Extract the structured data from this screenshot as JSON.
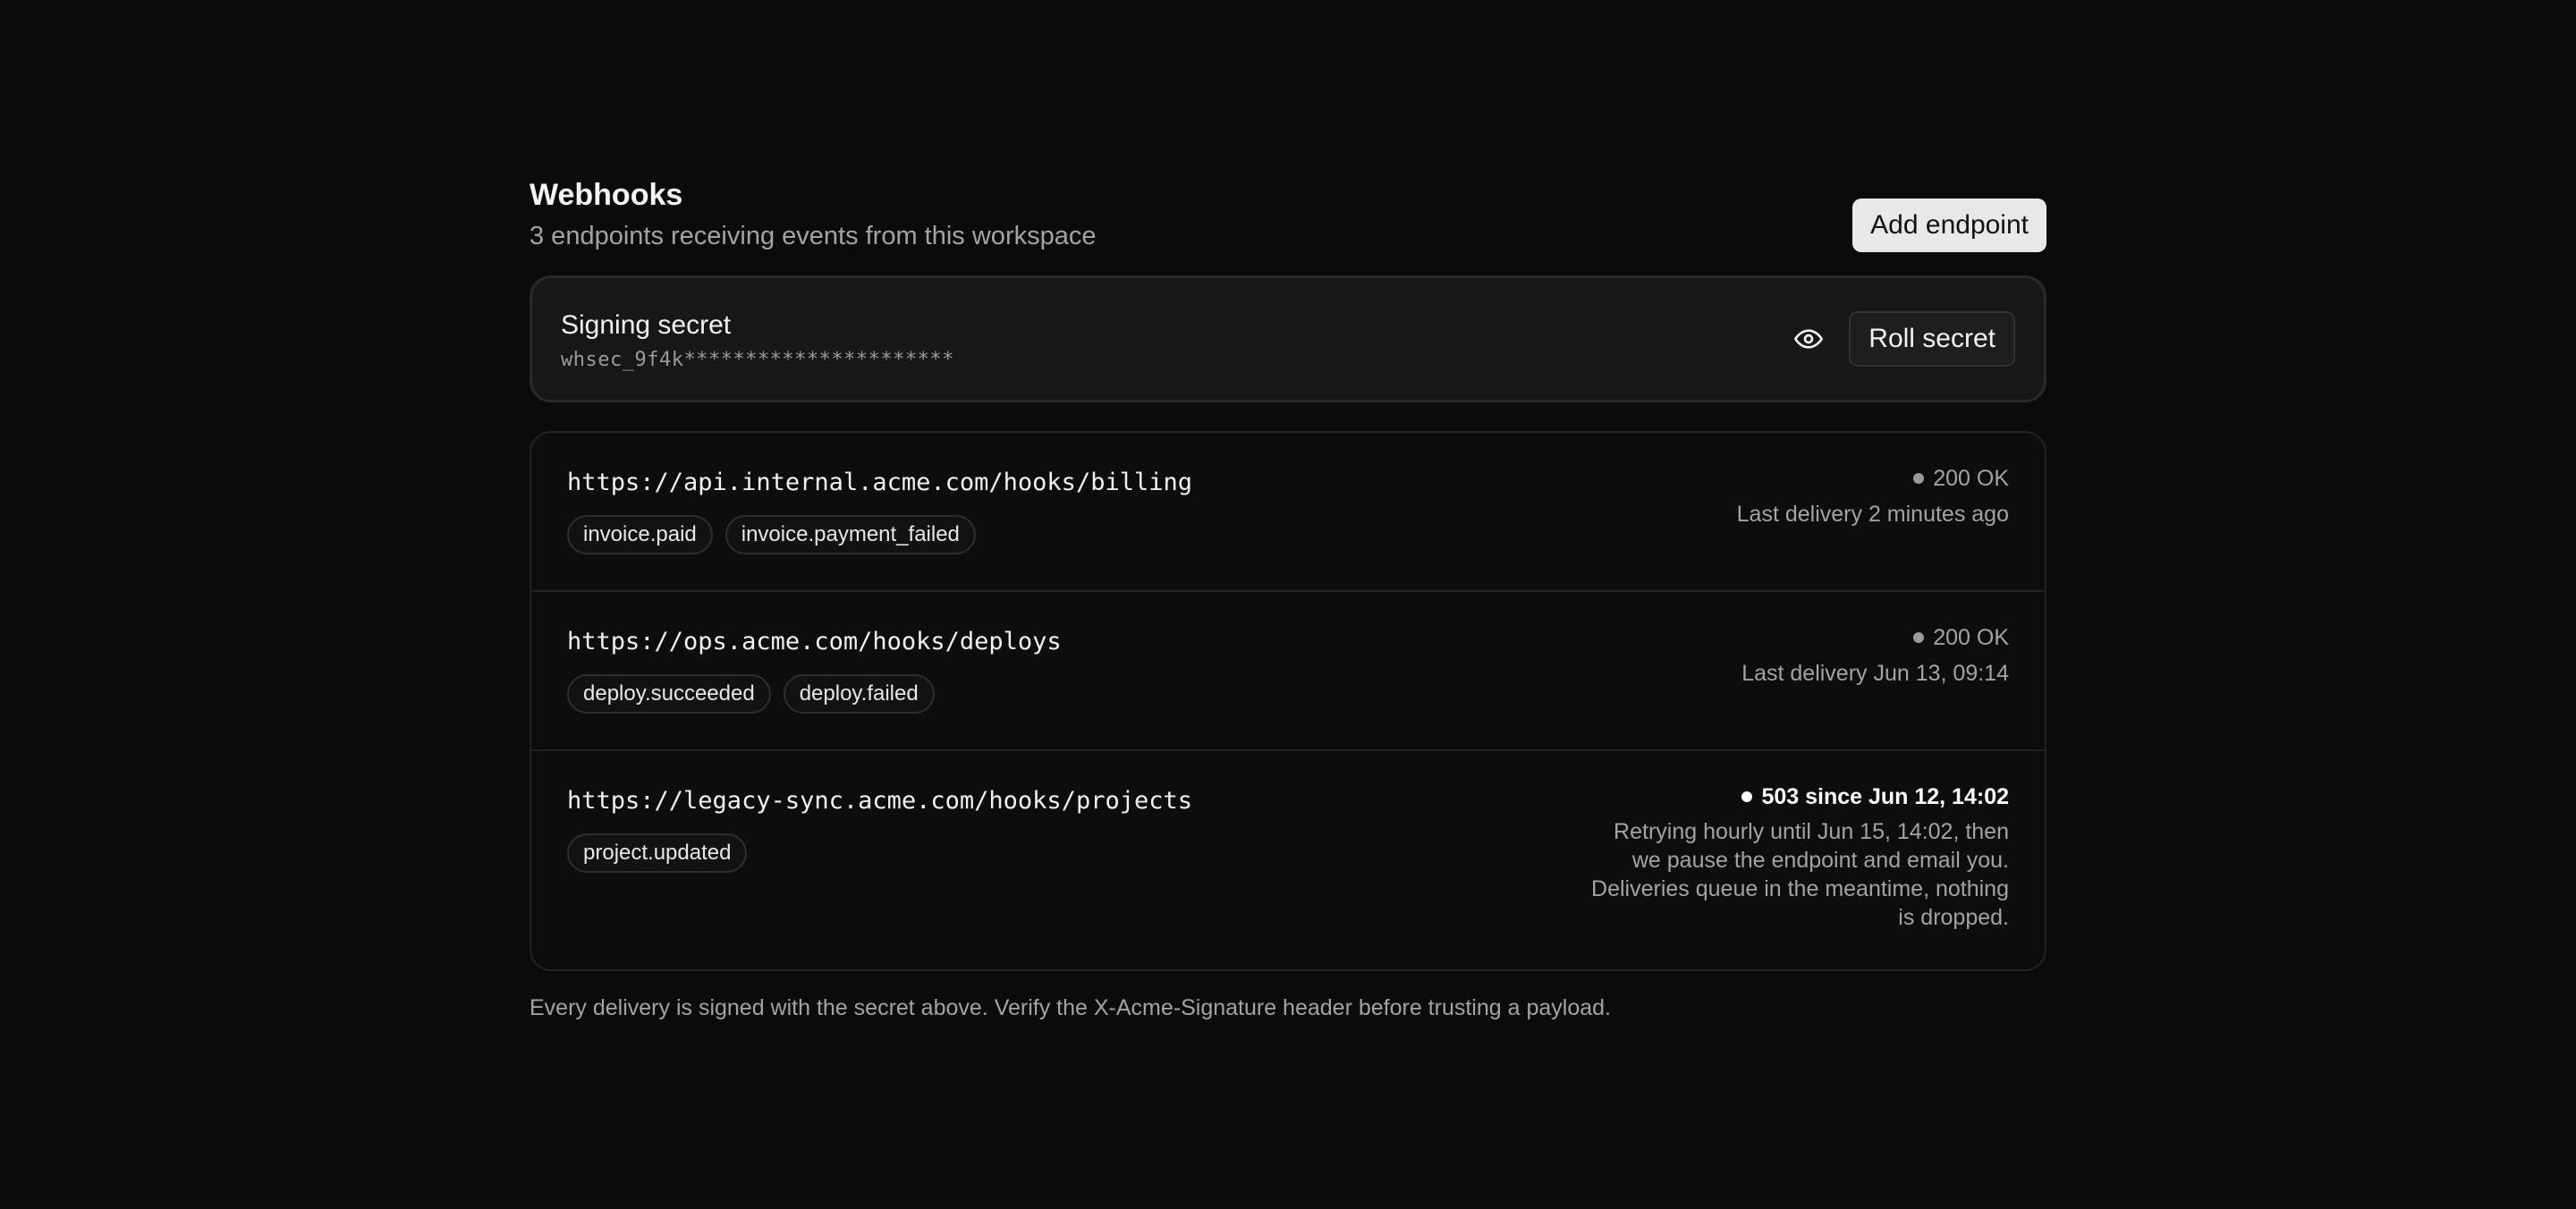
{
  "header": {
    "title": "Webhooks",
    "subtitle": "3 endpoints receiving events from this workspace",
    "add_button": "Add endpoint"
  },
  "secret": {
    "title": "Signing secret",
    "value": "whsec_9f4k**********************",
    "reveal_icon": "eye-icon",
    "roll_button": "Roll secret"
  },
  "endpoints": [
    {
      "url": "https://api.internal.acme.com/hooks/billing",
      "events": [
        "invoice.paid",
        "invoice.payment_failed"
      ],
      "status": "200 OK",
      "detail": "Last delivery 2 minutes ago"
    },
    {
      "url": "https://ops.acme.com/hooks/deploys",
      "events": [
        "deploy.succeeded",
        "deploy.failed"
      ],
      "status": "200 OK",
      "detail": "Last delivery Jun 13, 09:14"
    },
    {
      "url": "https://legacy-sync.acme.com/hooks/projects",
      "events": [
        "project.updated"
      ],
      "status": "503 since Jun 12, 14:02",
      "detail": "Retrying hourly until Jun 15, 14:02, then we pause the endpoint and email you. Deliveries queue in the meantime, nothing is dropped."
    }
  ],
  "footer": {
    "note": "Every delivery is signed with the secret above. Verify the X-Acme-Signature header before trusting a payload."
  },
  "colors": {
    "background": "#0b0b0b",
    "card": "#171717",
    "muted_text": "#a3a3a3",
    "error_status": "#ffffff"
  }
}
